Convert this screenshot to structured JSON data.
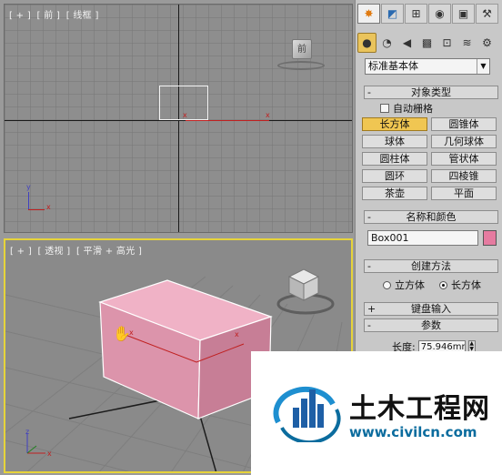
{
  "viewports": {
    "front": {
      "bracket_open": "[ + ]",
      "name": "[ 前 ]",
      "mode": "[ 线框 ]",
      "cube_label": "前"
    },
    "perspective": {
      "bracket_open": "[ + ]",
      "name": "[ 透视 ]",
      "mode": "[ 平滑 + 高光 ]"
    },
    "gizmo": {
      "x": "x",
      "y": "y",
      "z": "z"
    },
    "active_border_color": "#e6d33a"
  },
  "command_panel": {
    "tabs": [
      "create-icon",
      "modify-icon",
      "hierarchy-icon",
      "motion-icon",
      "display-icon",
      "utilities-icon"
    ],
    "subtabs": [
      "geometry-icon",
      "shapes-icon",
      "lights-icon",
      "cameras-icon",
      "helpers-icon",
      "spacewarps-icon",
      "systems-icon"
    ],
    "category_dropdown": "标准基本体",
    "object_type": {
      "title": "对象类型",
      "autogrid_label": "自动栅格",
      "buttons": [
        "长方体",
        "圆锥体",
        "球体",
        "几何球体",
        "圆柱体",
        "管状体",
        "圆环",
        "四棱锥",
        "茶壶",
        "平面"
      ],
      "active": "长方体"
    },
    "name_color": {
      "title": "名称和颜色",
      "name_value": "Box001",
      "color": "#e57ba0"
    },
    "creation_method": {
      "title": "创建方法",
      "option_cube": "立方体",
      "option_box": "长方体",
      "selected": "长方体"
    },
    "keyboard_entry": {
      "title": "键盘输入"
    },
    "parameters": {
      "title": "参数",
      "length_label": "长度:",
      "length_value": "75.946mm"
    },
    "collapse_symbol": "-",
    "expand_symbol": "+"
  },
  "watermark": {
    "title": "土木工程网",
    "url": "www.civilcn.com",
    "accent_color": "#0b6c9e"
  }
}
